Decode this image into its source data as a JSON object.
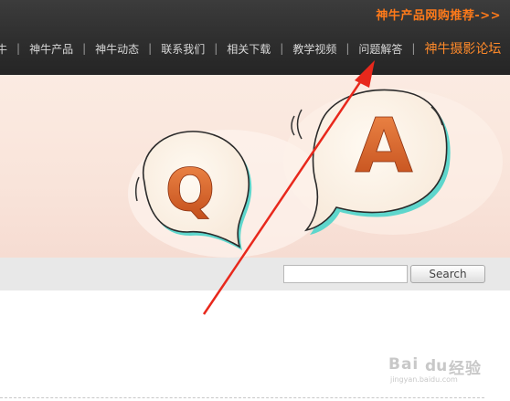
{
  "header": {
    "promo_text": "神牛产品网购推荐->>",
    "nav_items": [
      "牛",
      "神牛产品",
      "神牛动态",
      "联系我们",
      "相关下载",
      "教学视频",
      "问题解答"
    ],
    "nav_highlight": "神牛摄影论坛",
    "separator": "|"
  },
  "banner": {
    "q_letter": "Q",
    "a_letter": "A"
  },
  "search": {
    "input_value": "",
    "button_label": "Search"
  },
  "watermark": {
    "text_left": "Bai",
    "text_right": "经验",
    "paw": "du",
    "sub": "jingyan.baidu.com"
  },
  "colors": {
    "header_bg": "#2e2e2e",
    "accent_orange": "#ff7a1a",
    "arrow_red": "#e8281c",
    "banner_bg": "#fbebe2"
  }
}
